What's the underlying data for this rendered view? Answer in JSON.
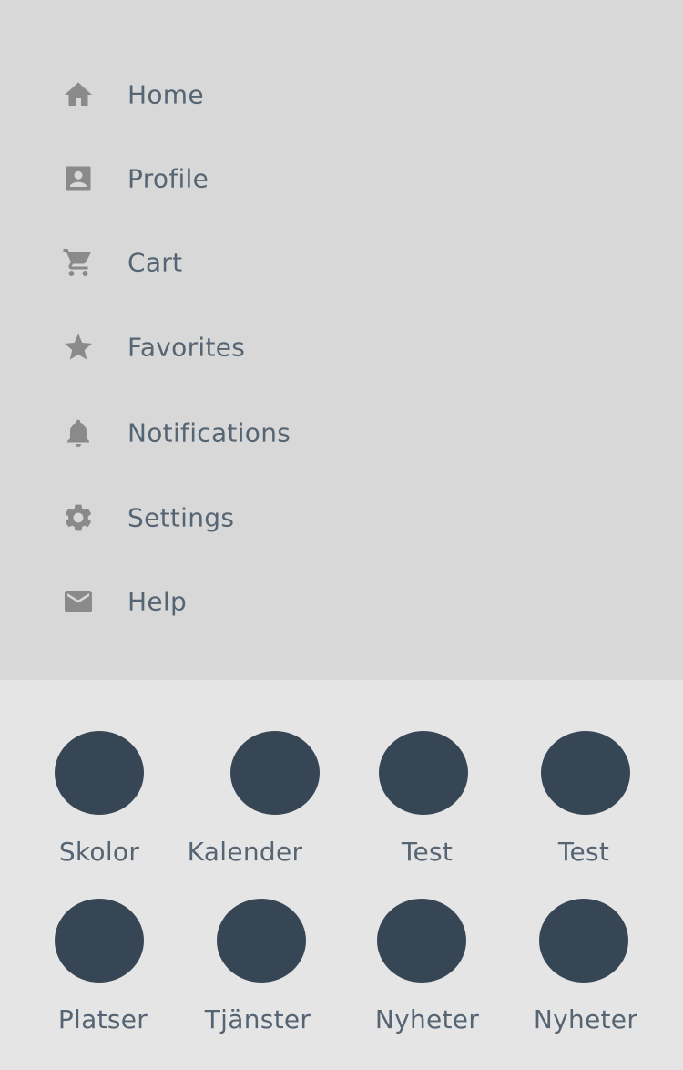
{
  "menu": {
    "items": [
      {
        "label": "Home",
        "icon": "home-icon"
      },
      {
        "label": "Profile",
        "icon": "contact-card-icon"
      },
      {
        "label": "Cart",
        "icon": "cart-icon"
      },
      {
        "label": "Favorites",
        "icon": "star-icon"
      },
      {
        "label": "Notifications",
        "icon": "bell-icon"
      },
      {
        "label": "Settings",
        "icon": "gear-icon"
      },
      {
        "label": "Help",
        "icon": "envelope-icon"
      }
    ],
    "icon_color": "#8a8a8a",
    "text_color": "#566574",
    "background": "#d8d8d8"
  },
  "grid": {
    "items": [
      {
        "label": "Skolor"
      },
      {
        "label": "Kalender"
      },
      {
        "label": "Test"
      },
      {
        "label": "Test"
      },
      {
        "label": "Platser"
      },
      {
        "label": "Tjänster"
      },
      {
        "label": "Nyheter"
      },
      {
        "label": "Nyheter"
      }
    ],
    "circle_color": "#374655",
    "background": "#e5e5e5"
  }
}
